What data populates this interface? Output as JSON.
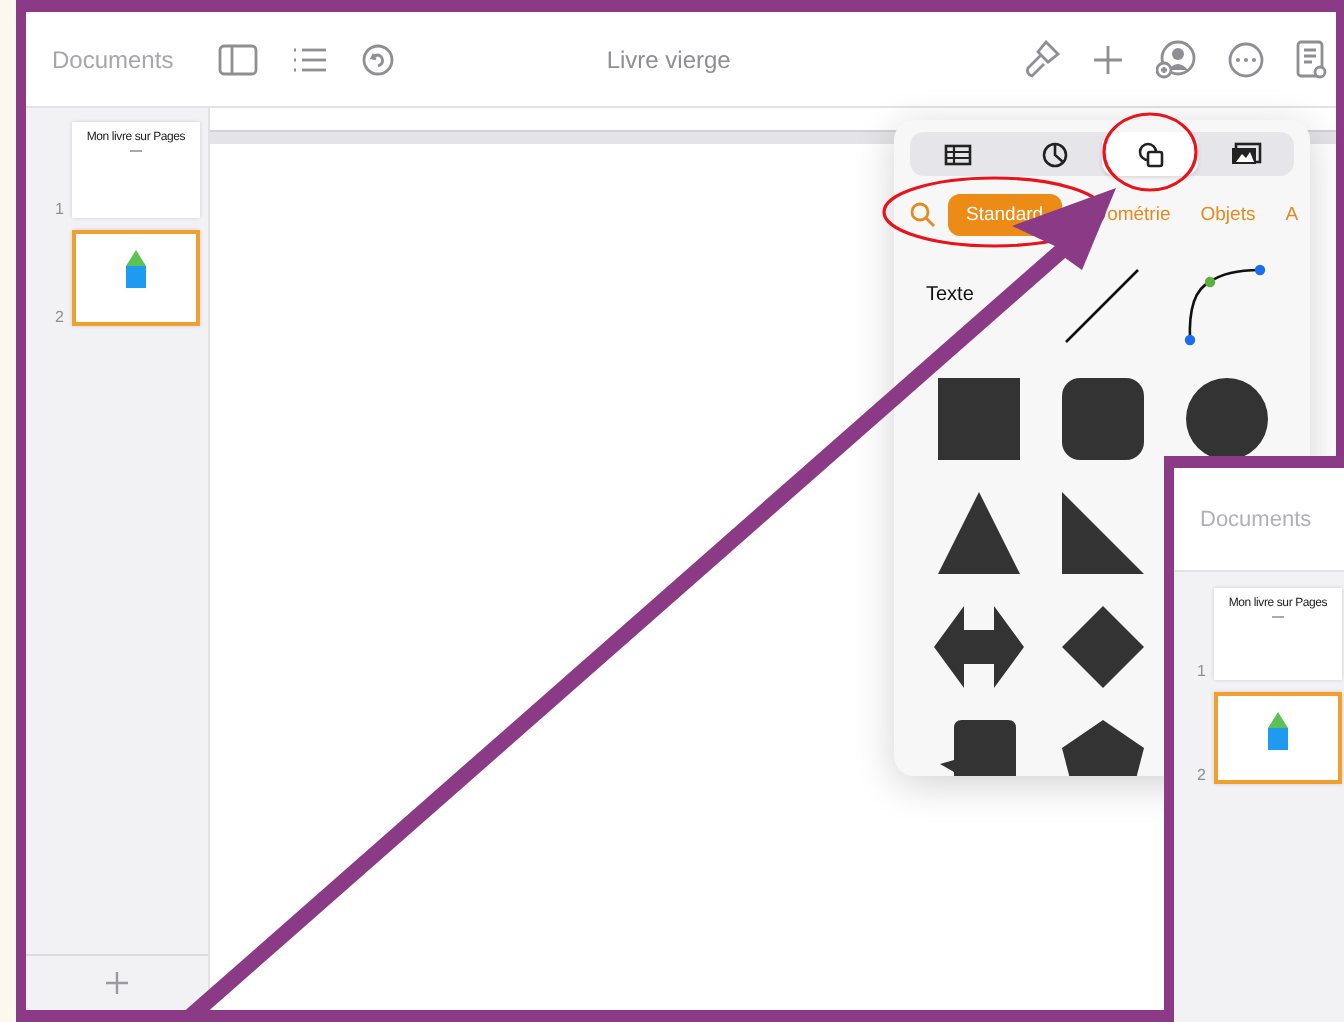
{
  "window": {
    "back_label": "Documents",
    "title": "Livre vierge"
  },
  "sidebar": {
    "pages": [
      {
        "number": "1",
        "title": "Mon livre sur Pages",
        "selected": false
      },
      {
        "number": "2",
        "selected": true
      }
    ]
  },
  "popover": {
    "segments": [
      {
        "kind": "table",
        "selected": false
      },
      {
        "kind": "chart",
        "selected": false
      },
      {
        "kind": "shape",
        "selected": true
      },
      {
        "kind": "media",
        "selected": false
      }
    ],
    "categories": [
      {
        "label": "Standard",
        "selected": true
      },
      {
        "label": "ométrie",
        "selected": false
      },
      {
        "label": "Objets",
        "selected": false
      },
      {
        "label": "A",
        "selected": false
      }
    ],
    "rows": [
      [
        {
          "kind": "text",
          "label": "Texte"
        },
        {
          "kind": "line"
        },
        {
          "kind": "curve"
        }
      ],
      [
        {
          "kind": "square"
        },
        {
          "kind": "rounded-square"
        },
        {
          "kind": "circle"
        }
      ],
      [
        {
          "kind": "triangle"
        },
        {
          "kind": "right-triangle"
        }
      ],
      [
        {
          "kind": "double-arrow"
        },
        {
          "kind": "diamond"
        }
      ],
      [
        {
          "kind": "speech-bubble"
        },
        {
          "kind": "pentagon"
        }
      ]
    ]
  },
  "inset": {
    "back_label": "Documents",
    "pages": [
      {
        "number": "1",
        "title": "Mon livre sur Pages",
        "selected": false
      },
      {
        "number": "2",
        "selected": true
      }
    ]
  }
}
